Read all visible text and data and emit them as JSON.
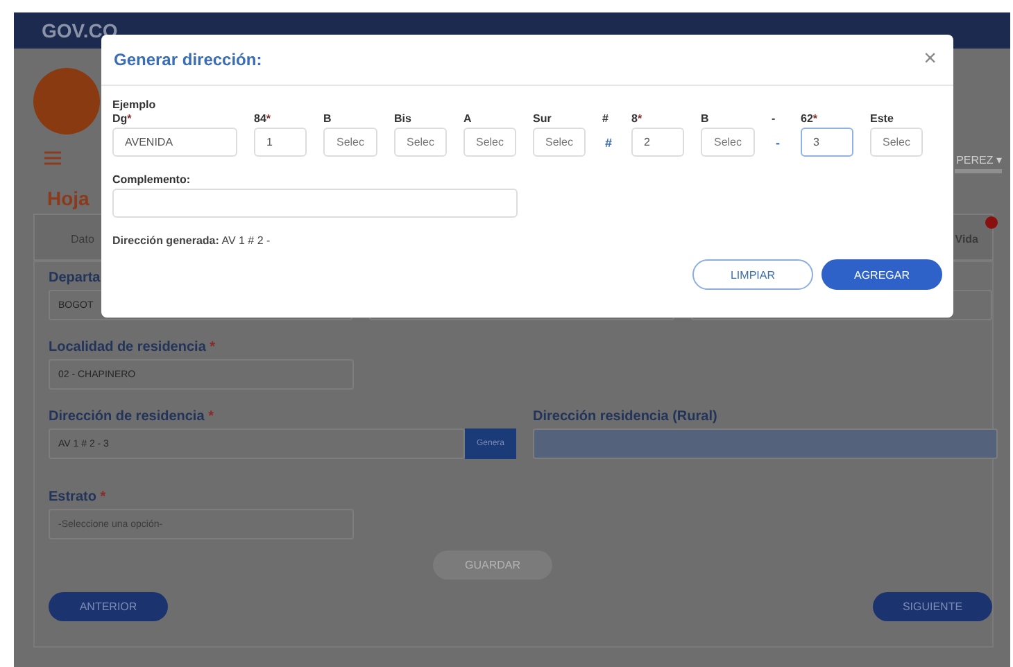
{
  "header": {
    "logo_text": "GOV.CO"
  },
  "user": {
    "name": "PEREZ",
    "caret": "▾"
  },
  "page_title": "Hoja",
  "tabs": [
    {
      "label": "Dato",
      "selected": false,
      "alert": false
    },
    {
      "label": "Vida",
      "selected": false,
      "alert": true
    }
  ],
  "form": {
    "department": {
      "label": "Departa",
      "value": "BOGOT"
    },
    "locality": {
      "label": "Localidad de residencia",
      "required_mark": "*",
      "value": "02 - CHAPINERO"
    },
    "address": {
      "label": "Dirección de residencia",
      "required_mark": "*",
      "value": "AV 1 # 2 - 3",
      "button": "Genera"
    },
    "rural_address": {
      "label": "Dirección residencia (Rural)",
      "disabled": true
    },
    "stratum": {
      "label": "Estrato",
      "required_mark": "*",
      "placeholder": "-Seleccione una opción-"
    },
    "save_button": {
      "label": "GUARDAR",
      "disabled": true
    },
    "previous_button": "ANTERIOR",
    "next_button": "SIGUIENTE"
  },
  "modal": {
    "title": "Generar dirección:",
    "close": "×",
    "example_label": "Ejemplo",
    "parts": [
      {
        "kind": "input",
        "label": "Dg",
        "required_mark": "*",
        "value": "AVENIDA",
        "focused": false
      },
      {
        "kind": "input",
        "label": "84",
        "required_mark": "*",
        "value": "1",
        "focused": false
      },
      {
        "kind": "select",
        "label": "B",
        "placeholder": "Selec"
      },
      {
        "kind": "select",
        "label": "Bis",
        "placeholder": "Selec"
      },
      {
        "kind": "select",
        "label": "A",
        "placeholder": "Selec"
      },
      {
        "kind": "select",
        "label": "Sur",
        "placeholder": "Selec"
      },
      {
        "kind": "separator",
        "label": "#",
        "symbol": "#"
      },
      {
        "kind": "input",
        "label": "8",
        "required_mark": "*",
        "value": "2",
        "focused": false
      },
      {
        "kind": "select",
        "label": "B",
        "placeholder": "Selec"
      },
      {
        "kind": "separator",
        "label": "-",
        "symbol": "-"
      },
      {
        "kind": "input",
        "label": "62",
        "required_mark": "*",
        "value": "3",
        "focused": true
      },
      {
        "kind": "select",
        "label": "Este",
        "placeholder": "Selec"
      }
    ],
    "complement": {
      "label": "Complemento:"
    },
    "generated": {
      "label": "Dirección generada:",
      "value": "AV 1 # 2 -"
    },
    "buttons": [
      {
        "label": "LIMPIAR",
        "kind": "outline"
      },
      {
        "label": "AGREGAR",
        "kind": "primary"
      }
    ]
  }
}
